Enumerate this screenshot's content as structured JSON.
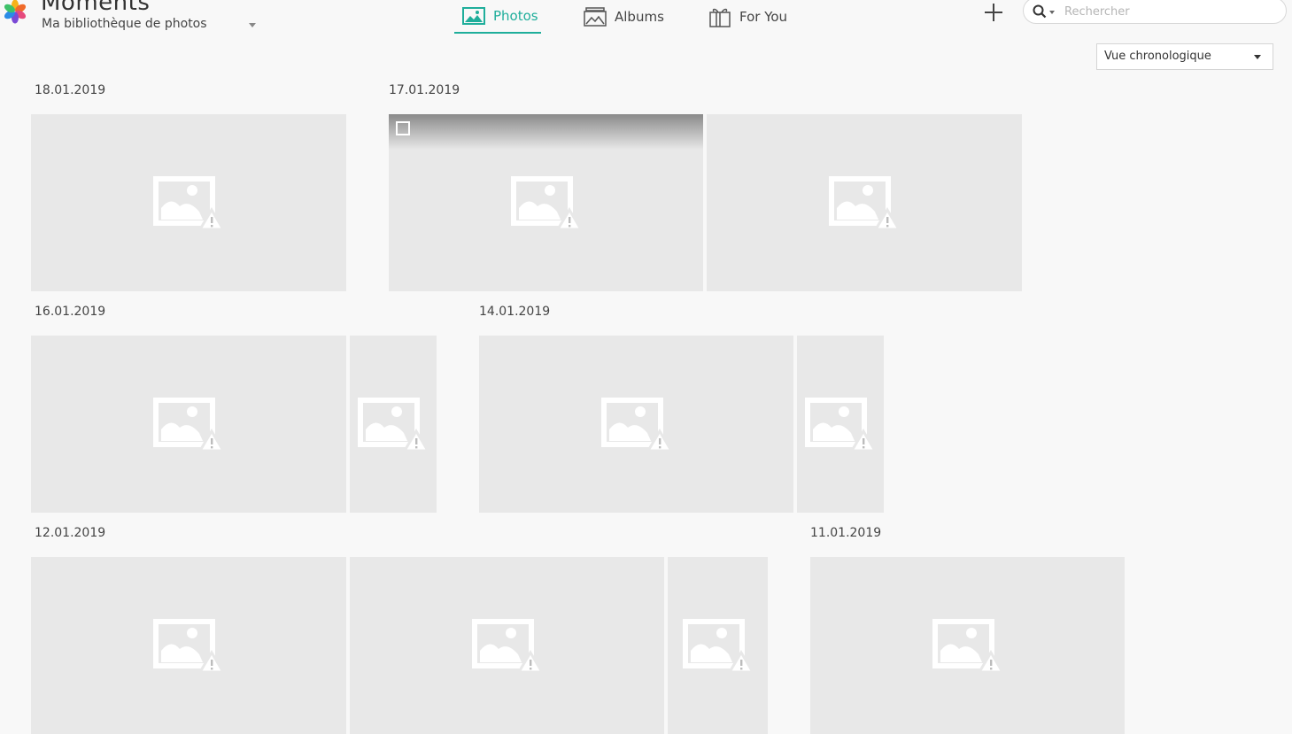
{
  "app": {
    "title": "Moments",
    "library_label": "Ma bibliothèque de photos"
  },
  "nav": {
    "tabs": [
      {
        "label": "Photos",
        "icon": "photo-icon",
        "active": true
      },
      {
        "label": "Albums",
        "icon": "albums-icon",
        "active": false
      },
      {
        "label": "For You",
        "icon": "gift-icon",
        "active": false
      }
    ]
  },
  "toolbar": {
    "add_icon": "plus-icon",
    "search_placeholder": "Rechercher",
    "search_value": ""
  },
  "view_mode": {
    "selected": "Vue chronologique"
  },
  "colors": {
    "accent": "#1fae9b",
    "background": "#f8f8f8",
    "thumbnail": "#e8e8e8"
  },
  "groups": [
    {
      "date": "18.01.2019",
      "photo_count": 1
    },
    {
      "date": "17.01.2019",
      "photo_count": 2
    },
    {
      "date": "16.01.2019",
      "photo_count": 2
    },
    {
      "date": "14.01.2019",
      "photo_count": 2
    },
    {
      "date": "12.01.2019",
      "photo_count": 3
    },
    {
      "date": "11.01.2019",
      "photo_count": 1
    }
  ]
}
